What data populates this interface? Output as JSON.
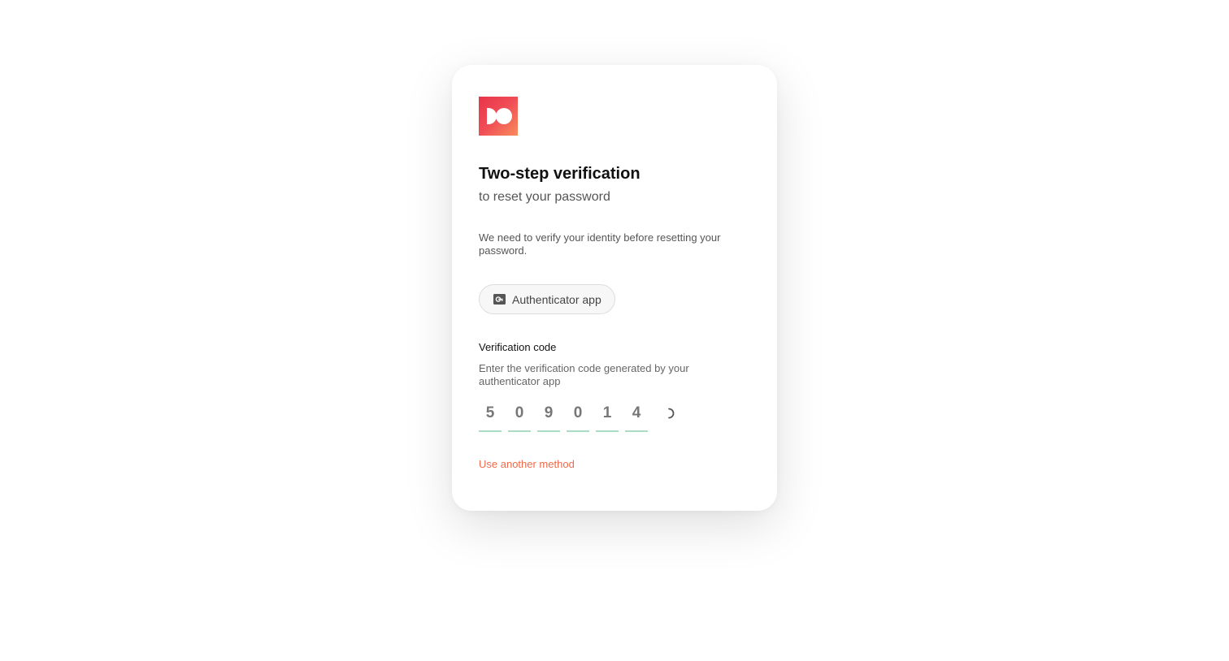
{
  "brand": {
    "logo_icon": "brand-logo-icon",
    "gradient": [
      "#e8344a",
      "#f98c5c"
    ]
  },
  "heading": {
    "title": "Two-step verification",
    "subtitle": "to reset your password"
  },
  "description": "We need to verify your identity before resetting your password.",
  "method": {
    "label": "Authenticator app",
    "icon": "authenticator-icon"
  },
  "verification": {
    "label": "Verification code",
    "help": "Enter the verification code generated by your authenticator app",
    "digits": [
      "5",
      "0",
      "9",
      "0",
      "1",
      "4"
    ],
    "status_icon": "loading-spinner-icon"
  },
  "alternate_link": "Use another method",
  "colors": {
    "accent": "#f06a4a",
    "code_underline": "#a9dcc3",
    "text_primary": "#111111",
    "text_secondary": "#555555"
  }
}
